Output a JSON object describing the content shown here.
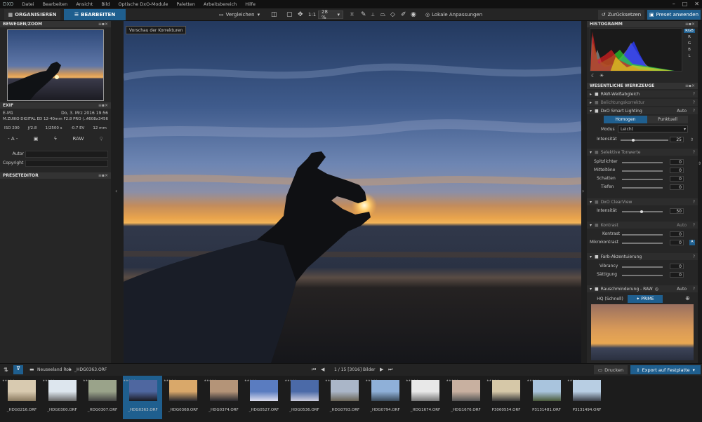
{
  "app": {
    "logo": "DXO"
  },
  "menu": [
    "Datei",
    "Bearbeiten",
    "Ansicht",
    "Bild",
    "Optische DxO-Module",
    "Paletten",
    "Arbeitsbereich",
    "Hilfe"
  ],
  "tabs": {
    "organize": "ORGANISIEREN",
    "edit": "BEARBEITEN"
  },
  "toolbar": {
    "compare": "Vergleichen",
    "one_to_one": "1:1",
    "zoom": "28 %",
    "local": "Lokale Anpassungen",
    "reset": "Zurücksetzen",
    "apply_preset": "Preset anwenden"
  },
  "left": {
    "nav_title": "BEWEGEN/ZOOM",
    "exif_title": "EXIF",
    "camera": "E-M1",
    "date": "Do, 3. Mrz 2016 19:56",
    "lens": "M.ZUIKO DIGITAL ED 12-40mm F2.8 PRO (...",
    "dimensions": "4608x3456",
    "iso": "ISO 200",
    "aperture": "ƒ/2.8",
    "shutter": "1/2500 s",
    "ev": "-0.7 EV",
    "focal": "12 mm",
    "mode": "- A -",
    "raw": "RAW",
    "author_label": "Autor",
    "copyright_label": "Copyright",
    "preset_title": "PRESETEDITOR"
  },
  "preview_label": "Vorschau der Korrekturen",
  "right": {
    "histogram_title": "HISTOGRAMM",
    "channels": [
      "RGB",
      "R",
      "G",
      "B",
      "L"
    ],
    "tools_title": "WESENTLICHE WERKZEUGE",
    "wb": "RAW-Weißabgleich",
    "exposure": "Belichtungskorrektur",
    "smart_lighting": "DxO Smart Lighting",
    "auto": "Auto",
    "homogen": "Homogen",
    "punktuell": "Punktuell",
    "modus_label": "Modus",
    "modus_value": "Leicht",
    "intensity_label": "Intensität",
    "intensity_value": "25",
    "selective": "Selektive Tonwerte",
    "highlights": "Spitzlichter",
    "midtones": "Mitteltöne",
    "shadows": "Schatten",
    "blacks": "Tiefen",
    "highlights_v": "0",
    "midtones_v": "0",
    "shadows_v": "0",
    "blacks_v": "0",
    "clearview": "DxO ClearView",
    "cv_intensity": "Intensität",
    "cv_value": "50",
    "contrast_sec": "Kontrast",
    "contrast": "Kontrast",
    "micro": "Mikrokontrast",
    "contrast_v": "0",
    "micro_v": "0",
    "color_accent": "Farb-Akzentuierung",
    "vibrancy": "Vibrancy",
    "saturation": "Sättigung",
    "vibrancy_v": "0",
    "saturation_v": "0",
    "noise": "Rauschminderung - RAW",
    "hq": "HQ (Schnell)",
    "prime": "✦ PRIME"
  },
  "filmstrip": {
    "folder": "Neuseeland Roh",
    "current": "_HDG0363.ORF",
    "counter": "1 / 15 [3016] Bilder",
    "print": "Drucken",
    "export": "Export auf Festplatte",
    "files": [
      "_HDG0216.ORF",
      "_HDG0300.ORF",
      "_HDG0307.ORF",
      "_HDG0363.ORF",
      "_HDG0368.ORF",
      "_HDG0374.ORF",
      "_HDG0527.ORF",
      "_HDG0536.ORF",
      "_HDG0793.ORF",
      "_HDG0794.ORF",
      "_HDG1674.ORF",
      "_HDG1676.ORF",
      "P3060554.ORF",
      "P3131481.ORF",
      "P3131494.ORF"
    ]
  },
  "colors": {
    "accent": "#1f5f8f",
    "panel": "#262626"
  }
}
